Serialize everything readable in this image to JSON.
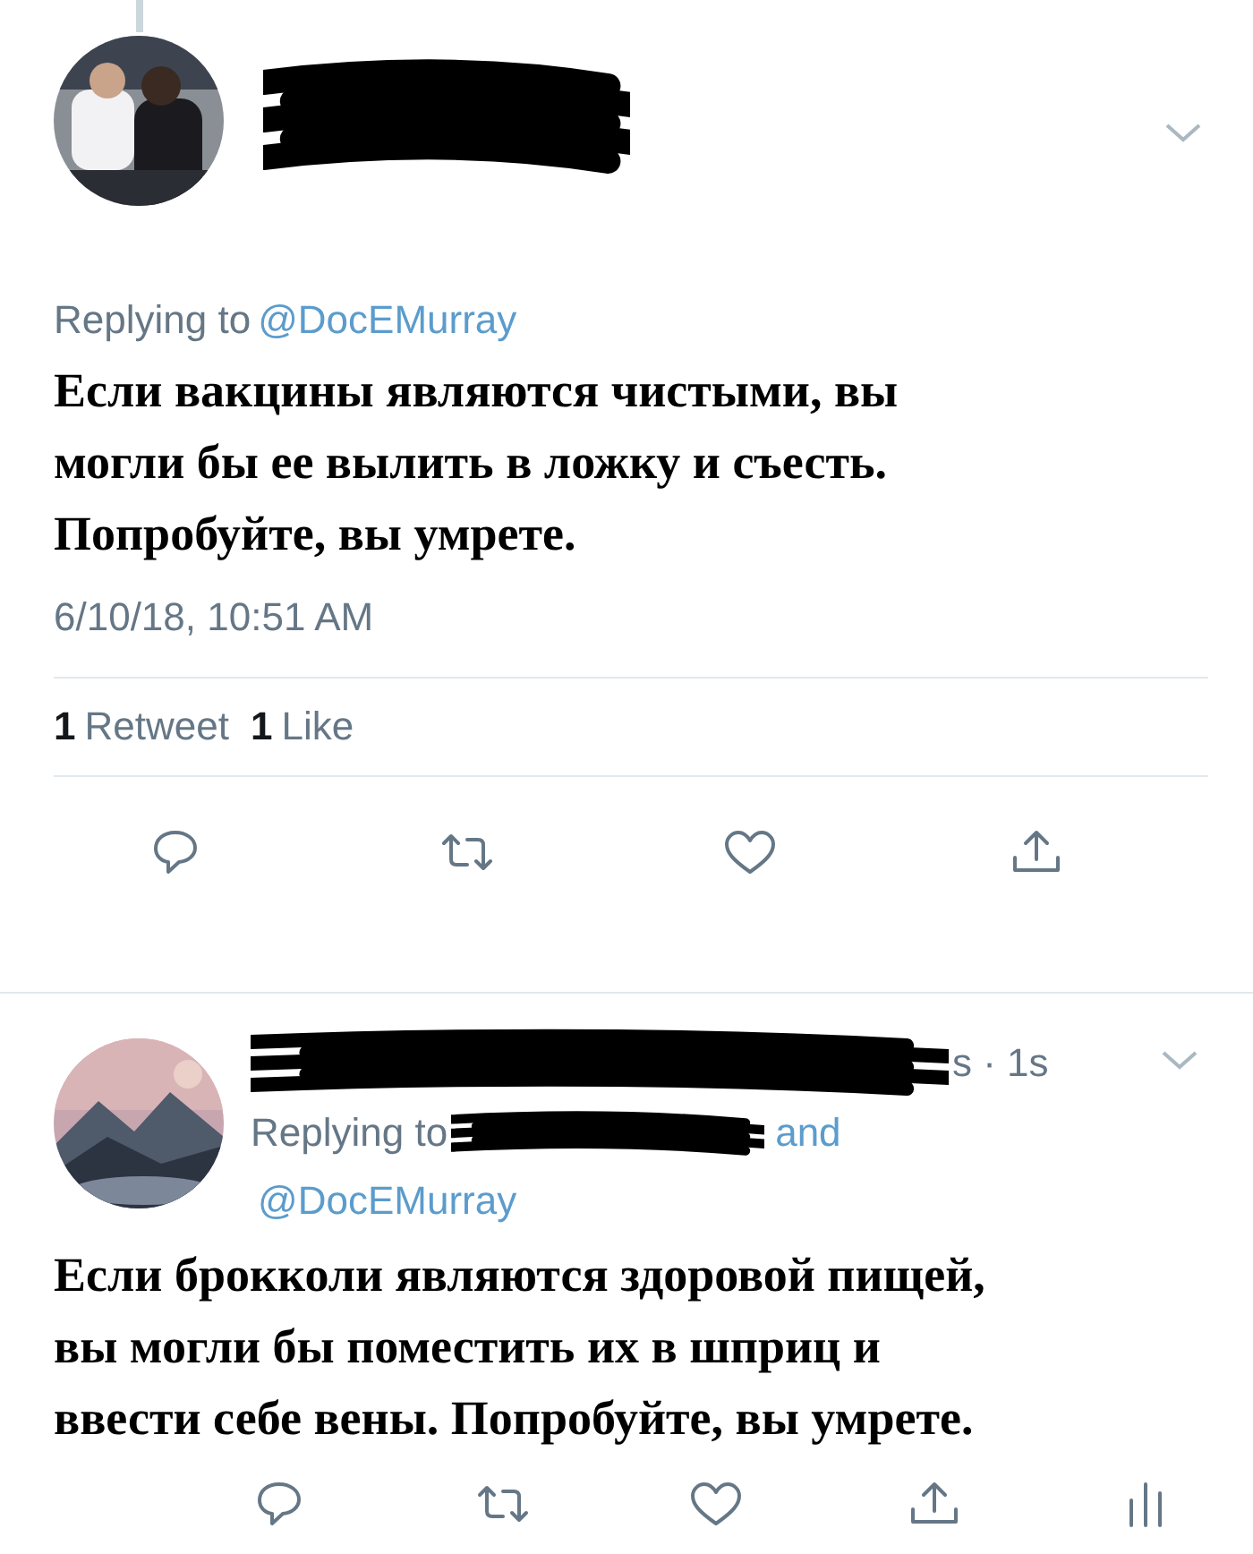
{
  "tweets": [
    {
      "kind": "focused",
      "replying_prefix": "Replying to",
      "replying_to": [
        "@DocEMurray"
      ],
      "text": "Если вакцины являются чистыми, вы\nмогли бы ее вылить в ложку и съесть.\nПопробуйте, вы умрете.",
      "timestamp": "6/10/18, 10:51 AM",
      "stats": [
        {
          "count": "1",
          "label": "Retweet"
        },
        {
          "count": "1",
          "label": "Like"
        }
      ],
      "actions": [
        {
          "kind": "reply"
        },
        {
          "kind": "retweet"
        },
        {
          "kind": "like"
        },
        {
          "kind": "share"
        }
      ]
    },
    {
      "kind": "reply",
      "meta": "s · 1s",
      "replying_prefix": "Replying to",
      "joiner": "and",
      "replying_to": [
        "@DocEMurray"
      ],
      "text": "Если брокколи являются здоровой пищей,\nвы могли бы поместить их в шприц и\nввести себе вены. Попробуйте, вы умрете.",
      "actions": [
        {
          "kind": "reply"
        },
        {
          "kind": "retweet"
        },
        {
          "kind": "like"
        },
        {
          "kind": "share"
        },
        {
          "kind": "analytics"
        }
      ]
    }
  ]
}
